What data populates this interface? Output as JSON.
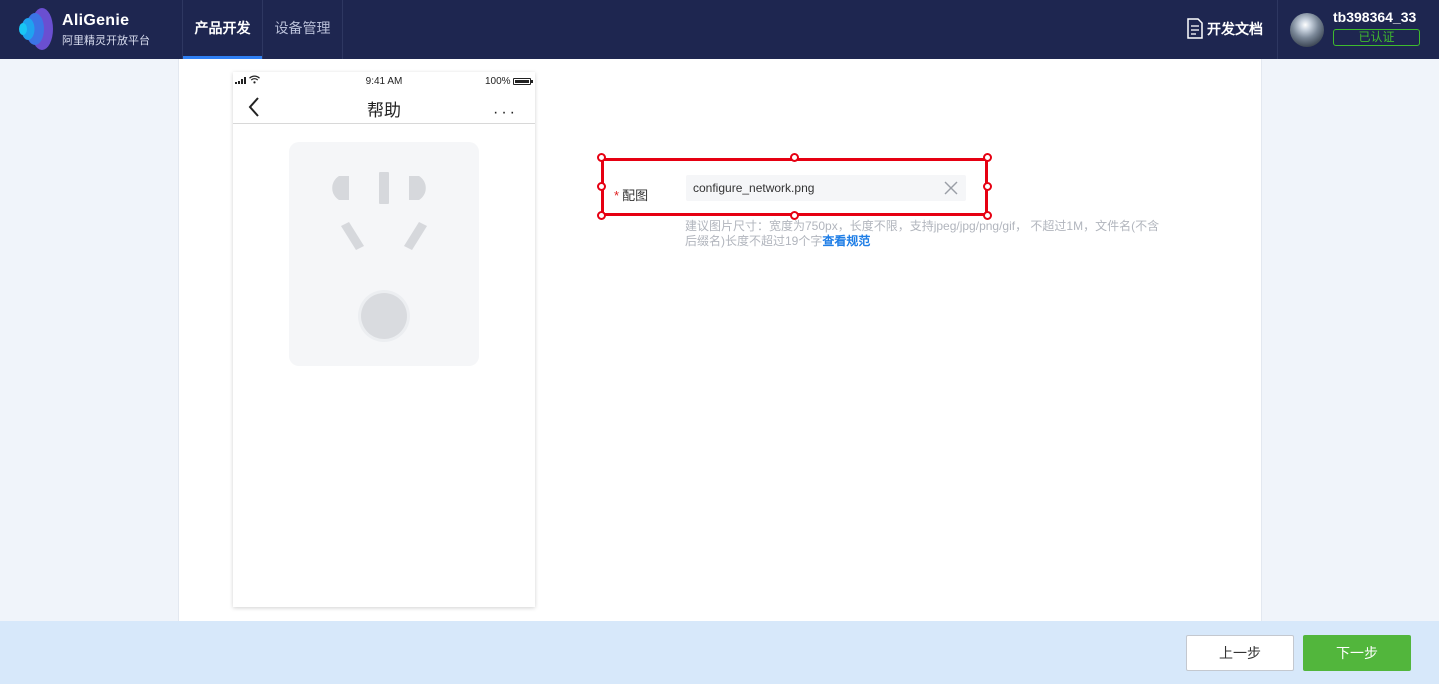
{
  "brand": {
    "name": "AliGenie",
    "subtitle": "阿里精灵开放平台"
  },
  "nav": {
    "tabs": [
      {
        "label": "产品开发",
        "active": true
      },
      {
        "label": "设备管理",
        "active": false
      }
    ]
  },
  "header": {
    "docs_label": "开发文档",
    "username": "tb398364_33",
    "verified_label": "已认证"
  },
  "phone_preview": {
    "time": "9:41 AM",
    "battery": "100%",
    "title": "帮助",
    "more": "···"
  },
  "form": {
    "field_label": "配图",
    "required_mark": "*",
    "file_name": "configure_network.png",
    "hint": "建议图片尺寸：宽度为750px，长度不限，支持jpeg/jpg/png/gif， 不超过1M，文件名(不含后缀名)长度不超过19个字",
    "hint_link": "查看规范"
  },
  "footer": {
    "prev_label": "上一步",
    "next_label": "下一步"
  },
  "colors": {
    "nav_bg": "#1e2650",
    "accent": "#2f7ff3",
    "next_button": "#52b63c",
    "selection": "#e60012",
    "verified": "#3fbb2e"
  }
}
